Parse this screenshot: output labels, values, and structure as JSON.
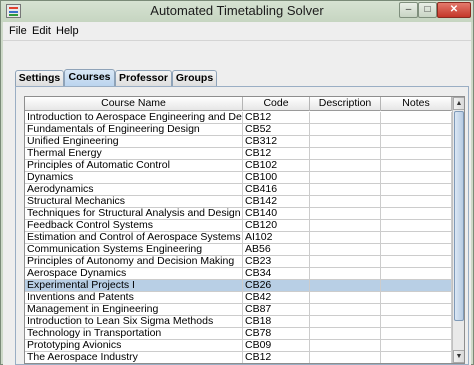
{
  "window": {
    "title": "Automated Timetabling Solver",
    "close_glyph": "✕",
    "min_glyph": "–",
    "max_glyph": "□"
  },
  "menu": [
    "File",
    "Edit",
    "Help"
  ],
  "tabs": [
    "Settings",
    "Courses",
    "Professor",
    "Groups"
  ],
  "active_tab": "Courses",
  "table": {
    "columns": [
      "Course Name",
      "Code",
      "Description",
      "Notes"
    ],
    "rows": [
      [
        "Introduction to Aerospace Engineering and Design",
        "CB12",
        "",
        ""
      ],
      [
        "Fundamentals of Engineering Design",
        "CB52",
        "",
        ""
      ],
      [
        "Unified Engineering",
        "CB312",
        "",
        ""
      ],
      [
        "Thermal Energy",
        "CB12",
        "",
        ""
      ],
      [
        "Principles of Automatic Control",
        "CB102",
        "",
        ""
      ],
      [
        "Dynamics",
        "CB100",
        "",
        ""
      ],
      [
        "Aerodynamics",
        "CB416",
        "",
        ""
      ],
      [
        "Structural Mechanics",
        "CB142",
        "",
        ""
      ],
      [
        "Techniques for Structural Analysis and Design",
        "CB140",
        "",
        ""
      ],
      [
        "Feedback Control Systems",
        "CB120",
        "",
        ""
      ],
      [
        "Estimation and Control of Aerospace Systems",
        "AI102",
        "",
        ""
      ],
      [
        "Communication Systems Engineering",
        "AB56",
        "",
        ""
      ],
      [
        "Principles of Autonomy and Decision Making",
        "CB23",
        "",
        ""
      ],
      [
        "Aerospace Dynamics",
        "CB34",
        "",
        ""
      ],
      [
        "Experimental Projects I",
        "CB26",
        "",
        ""
      ],
      [
        "Inventions and Patents",
        "CB42",
        "",
        ""
      ],
      [
        "Management in Engineering",
        "CB87",
        "",
        ""
      ],
      [
        "Introduction to Lean Six Sigma Methods",
        "CB18",
        "",
        ""
      ],
      [
        "Technology in Transportation",
        "CB78",
        "",
        ""
      ],
      [
        "Prototyping Avionics",
        "CB09",
        "",
        ""
      ],
      [
        "The Aerospace Industry",
        "CB12",
        "",
        ""
      ]
    ],
    "selected_row": 14
  },
  "scrollbar": {
    "up_glyph": "▲",
    "down_glyph": "▼"
  },
  "colors": {
    "selection": "#b8cfe5",
    "active_tab": "#b9d3ee",
    "close_button": "#c4372a"
  }
}
